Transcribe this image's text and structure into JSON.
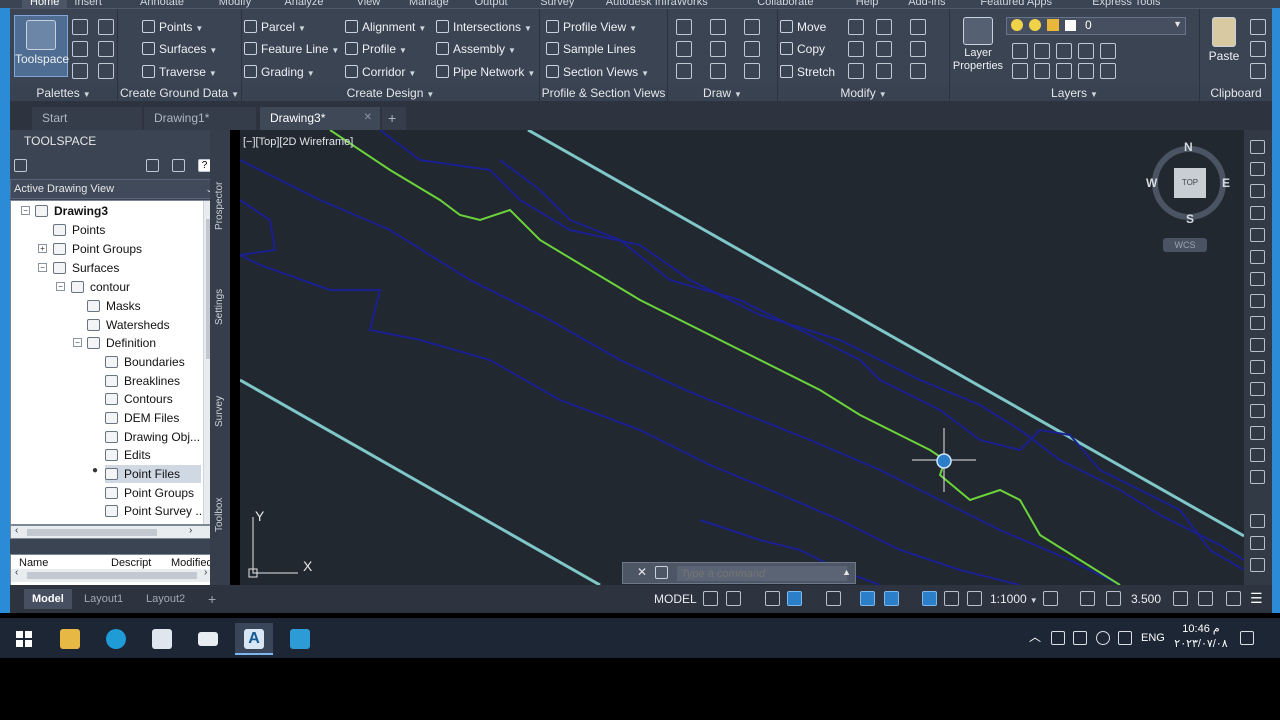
{
  "ribbon": {
    "tabs": [
      "Home",
      "Insert",
      "Annotate",
      "Modify",
      "Analyze",
      "View",
      "Manage",
      "Output",
      "Survey",
      "Autodesk InfraWorks",
      "Collaborate",
      "Help",
      "Add-ins",
      "Featured Apps",
      "Express Tools"
    ],
    "toolspace_label": "Toolspace",
    "palettes_label": "Palettes",
    "ground": {
      "title": "Create Ground Data",
      "points": "Points",
      "surfaces": "Surfaces",
      "traverse": "Traverse",
      "parcel": "Parcel",
      "feature_line": "Feature Line",
      "grading": "Grading"
    },
    "design": {
      "title": "Create Design",
      "alignment": "Alignment",
      "profile": "Profile",
      "corridor": "Corridor",
      "intersections": "Intersections",
      "assembly": "Assembly",
      "pipe_network": "Pipe Network"
    },
    "profile_section": {
      "title": "Profile & Section Views",
      "profile_view": "Profile View",
      "sample_lines": "Sample Lines",
      "section_views": "Section Views"
    },
    "draw_title": "Draw",
    "modify": {
      "title": "Modify",
      "move": "Move",
      "copy": "Copy",
      "stretch": "Stretch"
    },
    "layers": {
      "title": "Layers",
      "layer_properties": "Layer Properties",
      "current_layer": "0"
    },
    "clipboard": {
      "title": "Clipboard",
      "paste": "Paste"
    }
  },
  "doc_tabs": [
    {
      "label": "Start",
      "active": false
    },
    {
      "label": "Drawing1*",
      "active": false
    },
    {
      "label": "Drawing3*",
      "active": true
    }
  ],
  "toolspace": {
    "title": "TOOLSPACE",
    "view_select": "Active Drawing View",
    "side_tabs": [
      "Prospector",
      "Settings",
      "Survey",
      "Toolbox"
    ],
    "tree": {
      "drawing": "Drawing3",
      "points": "Points",
      "point_groups": "Point Groups",
      "surfaces": "Surfaces",
      "contour": "contour",
      "masks": "Masks",
      "watersheds": "Watersheds",
      "definition": "Definition",
      "boundaries": "Boundaries",
      "breaklines": "Breaklines",
      "contours": "Contours",
      "dem_files": "DEM Files",
      "drawing_obj": "Drawing Obj...",
      "edits": "Edits",
      "point_files": "Point Files",
      "point_groups_2": "Point Groups",
      "point_survey": "Point Survey ..."
    },
    "list_headers": {
      "name": "Name",
      "description": "Descript",
      "modified": "Modified"
    }
  },
  "canvas": {
    "view_label": "[−][Top][2D Wireframe]",
    "compass": {
      "n": "N",
      "s": "S",
      "e": "E",
      "w": "W",
      "top": "TOP"
    },
    "wcs": "WCS",
    "ucs": {
      "x": "X",
      "y": "Y"
    },
    "colors": {
      "background": "#212830",
      "contour_blue": "#1b1f8f",
      "contour_green": "#6bd33a",
      "boundary_cyan": "#7fc7c9"
    }
  },
  "command": {
    "placeholder": "Type a command"
  },
  "status": {
    "layout_tabs": [
      {
        "label": "Model",
        "active": true
      },
      {
        "label": "Layout1",
        "active": false
      },
      {
        "label": "Layout2",
        "active": false
      }
    ],
    "model": "MODEL",
    "scale": "1:1000",
    "annotation_value": "3.500"
  },
  "taskbar": {
    "lang": "ENG",
    "time": "10:46 م",
    "date": "٢٠٢٣/٠٧/٠٨"
  }
}
